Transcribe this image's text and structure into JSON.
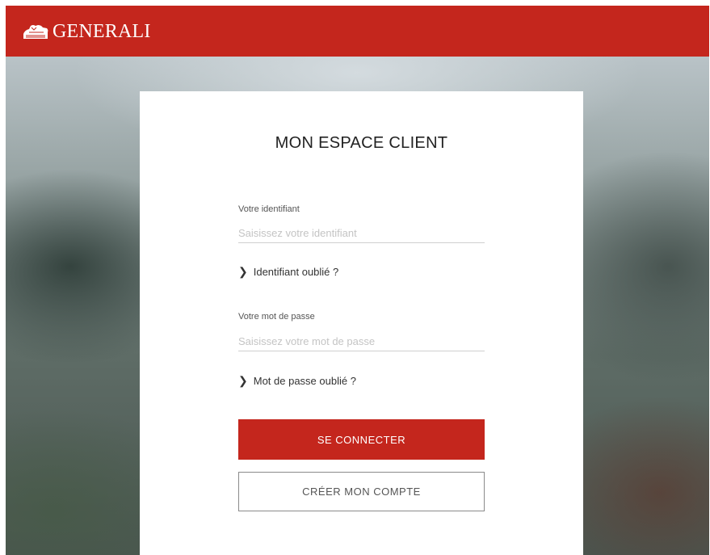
{
  "header": {
    "brand": "GENERALI",
    "logo_icon": "lion-logo-icon",
    "brand_color": "#c4261d"
  },
  "login": {
    "title": "MON ESPACE CLIENT",
    "identifier": {
      "label": "Votre identifiant",
      "placeholder": "Saisissez votre identifiant",
      "value": ""
    },
    "forgot_identifier": "Identifiant oublié ?",
    "password": {
      "label": "Votre mot de passe",
      "placeholder": "Saisissez votre mot de passe",
      "value": ""
    },
    "forgot_password": "Mot de passe oublié ?",
    "chevron_icon": "chevron-right-icon",
    "submit_label": "SE CONNECTER",
    "create_account_label": "CRÉER MON COMPTE"
  }
}
